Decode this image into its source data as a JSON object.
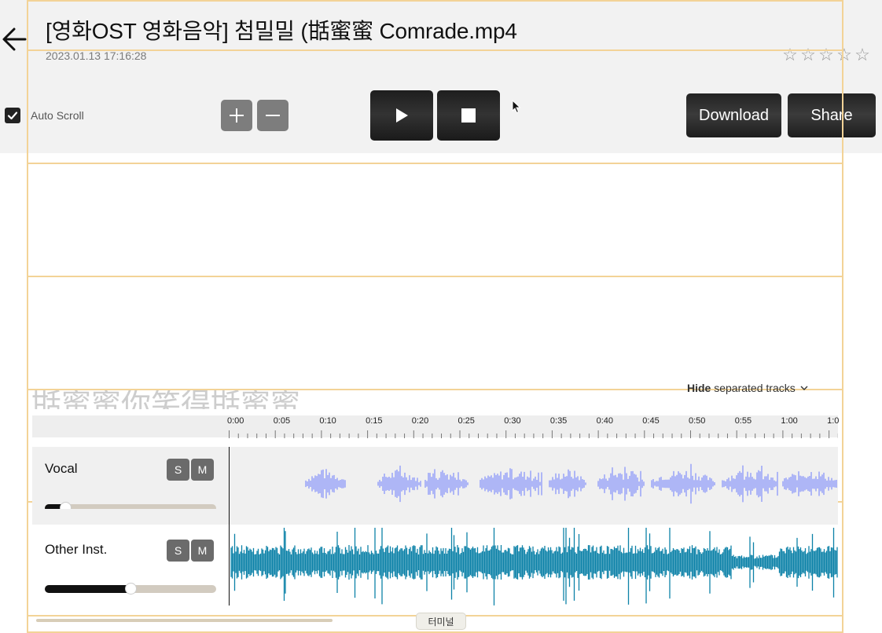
{
  "header": {
    "title": "[영화OST  영화음악] 첨밀밀 (甛蜜蜜 Comrade.mp4",
    "timestamp": "2023.01.13 17:16:28",
    "rating": {
      "value": 0,
      "max": 5,
      "icon": "star-outline-icon"
    }
  },
  "toolbar": {
    "auto_scroll_label": "Auto Scroll",
    "auto_scroll_checked": true,
    "zoom_in_icon": "plus-icon",
    "zoom_out_icon": "minus-icon",
    "play_icon": "play-icon",
    "stop_icon": "stop-icon",
    "download_label": "Download",
    "share_label": "Share"
  },
  "tracks_toggle": {
    "bold_label": "Hide",
    "rest_label": "separated tracks"
  },
  "lyrics_ghost": "甛蜜蜜你笑得甛蜜蜜",
  "timeline": {
    "labels": [
      "0:00",
      "0:05",
      "0:10",
      "0:15",
      "0:20",
      "0:25",
      "0:30",
      "0:35",
      "0:40",
      "0:45",
      "0:50",
      "0:55",
      "1:00",
      "1:0"
    ]
  },
  "tracks": [
    {
      "name": "Vocal",
      "solo_label": "S",
      "mute_label": "M",
      "volume": 0.12,
      "color": "#9ea7f7"
    },
    {
      "name": "Other Inst.",
      "solo_label": "S",
      "mute_label": "M",
      "volume": 0.5,
      "color": "#0d82a8"
    }
  ],
  "footer": {
    "terminal_label": "터미널"
  },
  "colors": {
    "header_bg": "#f2f2f2",
    "button_dark": "#222222",
    "guide": "#f3d397"
  }
}
